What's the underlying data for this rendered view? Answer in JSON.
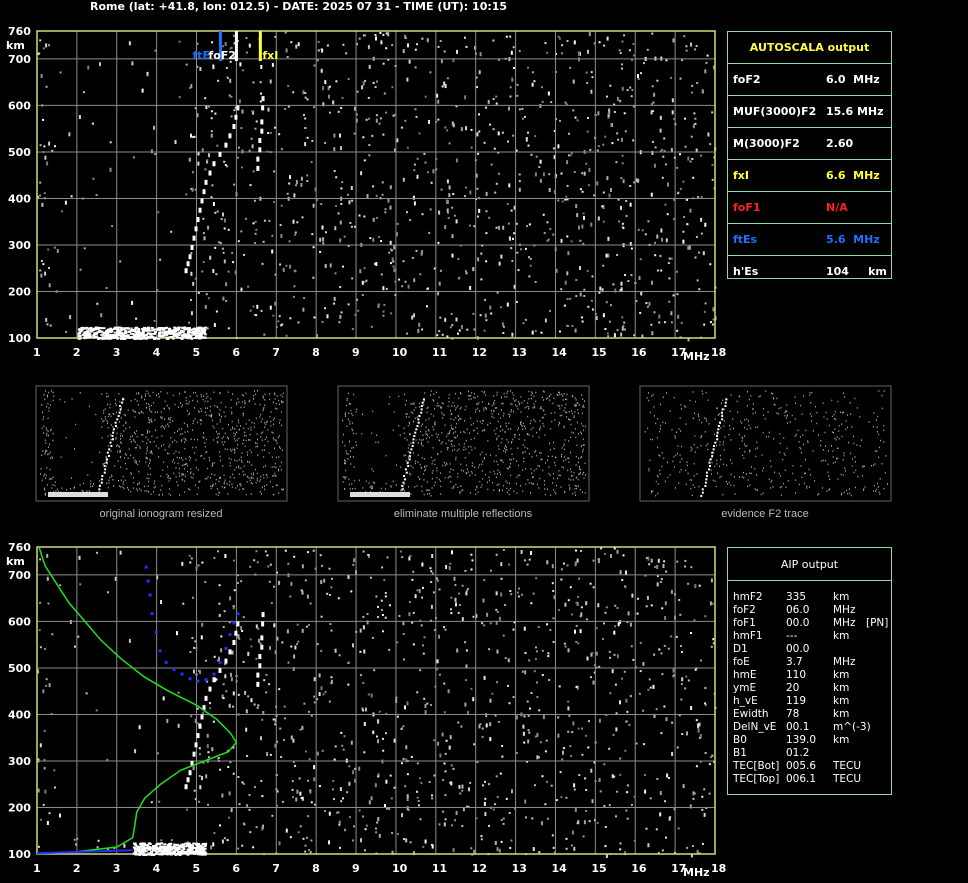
{
  "header": {
    "title": "Rome (lat: +41.8, lon: 012.5) - DATE: 2025 07 31 - TIME (UT): 10:15"
  },
  "colors": {
    "grid": "#8c8c8c",
    "frame": "#d8d880",
    "foF2": "#ffffff",
    "fxI": "#ffff40",
    "foF1": "#ff2020",
    "ftEs": "#2070ff",
    "profile": "#20e020",
    "trace_blue": "#2030ff",
    "box_border": "#8fd8a8"
  },
  "chart_data": [
    {
      "type": "scatter",
      "name_key": "main-ionogram",
      "xlabel": "MHz",
      "ylabel": "km",
      "xlim": [
        1,
        18
      ],
      "ylim": [
        100,
        760
      ],
      "x_ticks": [
        1,
        2,
        3,
        4,
        5,
        6,
        7,
        8,
        9,
        10,
        11,
        12,
        13,
        14,
        15,
        16,
        17,
        18
      ],
      "y_ticks": [
        100,
        200,
        300,
        400,
        500,
        600,
        700,
        760
      ],
      "grid": true,
      "markers": [
        {
          "label": "ftE",
          "x": 5.6,
          "color": "#2070ff"
        },
        {
          "label": "foF2",
          "x": 6.0,
          "color": "#ffffff"
        },
        {
          "label": "fxI",
          "x": 6.6,
          "color": "#ffff40"
        }
      ],
      "trace_points": [
        [
          4.7,
          250
        ],
        [
          4.75,
          265
        ],
        [
          4.8,
          280
        ],
        [
          4.85,
          300
        ],
        [
          4.9,
          320
        ],
        [
          4.95,
          340
        ],
        [
          5.0,
          360
        ],
        [
          5.05,
          380
        ],
        [
          5.1,
          400
        ],
        [
          5.15,
          420
        ],
        [
          5.2,
          440
        ],
        [
          5.3,
          460
        ],
        [
          5.4,
          480
        ],
        [
          5.55,
          500
        ],
        [
          5.7,
          520
        ],
        [
          5.8,
          540
        ],
        [
          5.9,
          560
        ],
        [
          5.95,
          580
        ],
        [
          6.0,
          600
        ],
        [
          6.5,
          470
        ],
        [
          6.5,
          490
        ],
        [
          6.55,
          510
        ],
        [
          6.55,
          530
        ],
        [
          6.6,
          550
        ],
        [
          6.6,
          570
        ],
        [
          6.62,
          600
        ],
        [
          6.63,
          620
        ]
      ],
      "es_layer": {
        "x_start": 2.0,
        "x_end": 5.2,
        "y_min": 100,
        "y_max": 125
      }
    },
    {
      "type": "scatter",
      "name_key": "aip-ionogram",
      "xlabel": "MHz",
      "ylabel": "km",
      "xlim": [
        1,
        18
      ],
      "ylim": [
        100,
        760
      ],
      "x_ticks": [
        1,
        2,
        3,
        4,
        5,
        6,
        7,
        8,
        9,
        10,
        11,
        12,
        13,
        14,
        15,
        16,
        17,
        18
      ],
      "y_ticks": [
        100,
        200,
        300,
        400,
        500,
        600,
        700,
        760
      ],
      "grid": true,
      "profile_curve": [
        [
          1.05,
          760
        ],
        [
          1.2,
          720
        ],
        [
          1.5,
          680
        ],
        [
          1.8,
          640
        ],
        [
          2.2,
          600
        ],
        [
          2.6,
          560
        ],
        [
          3.1,
          520
        ],
        [
          3.7,
          480
        ],
        [
          4.3,
          450
        ],
        [
          5.0,
          420
        ],
        [
          5.5,
          390
        ],
        [
          5.85,
          360
        ],
        [
          6.0,
          340
        ],
        [
          5.8,
          320
        ],
        [
          5.2,
          300
        ],
        [
          4.6,
          280
        ],
        [
          4.1,
          250
        ],
        [
          3.7,
          220
        ],
        [
          3.5,
          190
        ],
        [
          3.45,
          160
        ],
        [
          3.4,
          135
        ],
        [
          3.0,
          115
        ],
        [
          2.0,
          105
        ],
        [
          1.0,
          100
        ]
      ],
      "blue_trace": [
        [
          3.7,
          720
        ],
        [
          3.75,
          690
        ],
        [
          3.8,
          660
        ],
        [
          3.85,
          620
        ],
        [
          3.95,
          580
        ],
        [
          4.05,
          540
        ],
        [
          4.2,
          515
        ],
        [
          4.4,
          500
        ],
        [
          4.6,
          490
        ],
        [
          4.8,
          480
        ],
        [
          5.0,
          475
        ],
        [
          5.2,
          478
        ],
        [
          5.4,
          490
        ],
        [
          5.55,
          515
        ],
        [
          5.7,
          545
        ],
        [
          5.8,
          575
        ],
        [
          5.9,
          600
        ],
        [
          6.0,
          620
        ]
      ]
    }
  ],
  "thumbnails": [
    {
      "caption": "original ionogram resized"
    },
    {
      "caption": "eliminate multiple reflections"
    },
    {
      "caption": "evidence F2 trace"
    }
  ],
  "autoscala": {
    "title": "AUTOSCALA output",
    "rows": [
      {
        "label": "foF2",
        "value": "6.0  MHz",
        "color": "#ffffff"
      },
      {
        "label": "MUF(3000)F2",
        "value": "15.6 MHz",
        "color": "#ffffff"
      },
      {
        "label": "M(3000)F2",
        "value": "2.60",
        "color": "#ffffff"
      },
      {
        "label": "fxI",
        "value": "6.6  MHz",
        "color": "#ffff40"
      },
      {
        "label": "foF1",
        "value": "N/A",
        "color": "#ff2020"
      },
      {
        "label": "ftEs",
        "value": "5.6  MHz",
        "color": "#2070ff"
      },
      {
        "label": "h'Es",
        "value": "104     km",
        "color": "#ffffff"
      }
    ]
  },
  "aip": {
    "title": "AIP output",
    "rows": [
      [
        "hmF2",
        "335",
        "km",
        ""
      ],
      [
        "foF2",
        "06.0",
        "MHz",
        ""
      ],
      [
        "foF1",
        "00.0",
        "MHz",
        "[PN]"
      ],
      [
        "hmF1",
        "---",
        "km",
        ""
      ],
      [
        "D1",
        "00.0",
        "",
        ""
      ],
      [
        "foE",
        "3.7",
        "MHz",
        ""
      ],
      [
        "hmE",
        "110",
        "km",
        ""
      ],
      [
        "ymE",
        "20",
        "km",
        ""
      ],
      [
        "h_vE",
        "119",
        "km",
        ""
      ],
      [
        "Ewidth",
        "78",
        "km",
        ""
      ],
      [
        "DelN_vE",
        "00.1",
        "m^(-3)",
        ""
      ],
      [
        "B0",
        "139.0",
        "km",
        ""
      ],
      [
        "B1",
        "01.2",
        "",
        ""
      ],
      [
        "TEC[Bot]",
        "005.6",
        "TECU",
        ""
      ],
      [
        "TEC[Top]",
        "006.1",
        "TECU",
        ""
      ]
    ]
  }
}
